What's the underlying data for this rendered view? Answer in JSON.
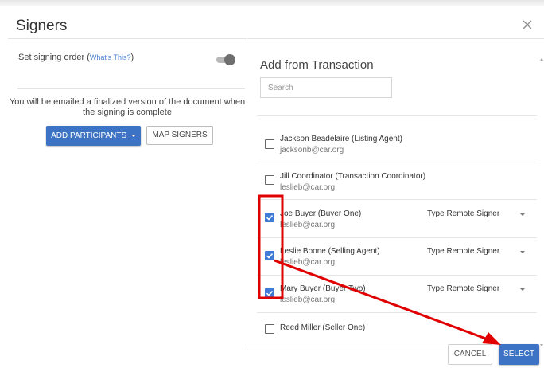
{
  "dialog": {
    "title": "Signers",
    "close_icon": "close-icon"
  },
  "left": {
    "signing_order_label": "Set signing order",
    "whats_this_label": "What's This?",
    "signing_order_enabled": false,
    "email_note": "You will be emailed a finalized version of the document when the signing is complete",
    "add_participants_label": "ADD PARTICIPANTS",
    "add_participants_icon": "caret-down-icon",
    "map_signers_label": "MAP SIGNERS"
  },
  "right": {
    "title": "Add from Transaction",
    "search_placeholder": "Search",
    "participants": [
      {
        "name": "Jackson Beadelaire (Listing Agent)",
        "email": "jacksonb@car.org",
        "checked": false
      },
      {
        "name": "Jill Coordinator (Transaction Coordinator)",
        "email": "leslieb@car.org",
        "checked": false
      },
      {
        "name": "Joe Buyer (Buyer One)",
        "email": "leslieb@car.org",
        "checked": true,
        "type": "Type  Remote Signer"
      },
      {
        "name": "Leslie Boone (Selling Agent)",
        "email": "leslieb@car.org",
        "checked": true,
        "type": "Type  Remote Signer"
      },
      {
        "name": "Mary Buyer (Buyer Two)",
        "email": "leslieb@car.org",
        "checked": true,
        "type": "Type  Remote Signer"
      },
      {
        "name": "Reed Miller (Seller One)",
        "email": "",
        "checked": false
      }
    ]
  },
  "footer": {
    "cancel_label": "CANCEL",
    "select_label": "SELECT"
  },
  "colors": {
    "primary": "#3d73c4",
    "checkbox_checked": "#3f7ad6",
    "annotation": "#e00000"
  }
}
